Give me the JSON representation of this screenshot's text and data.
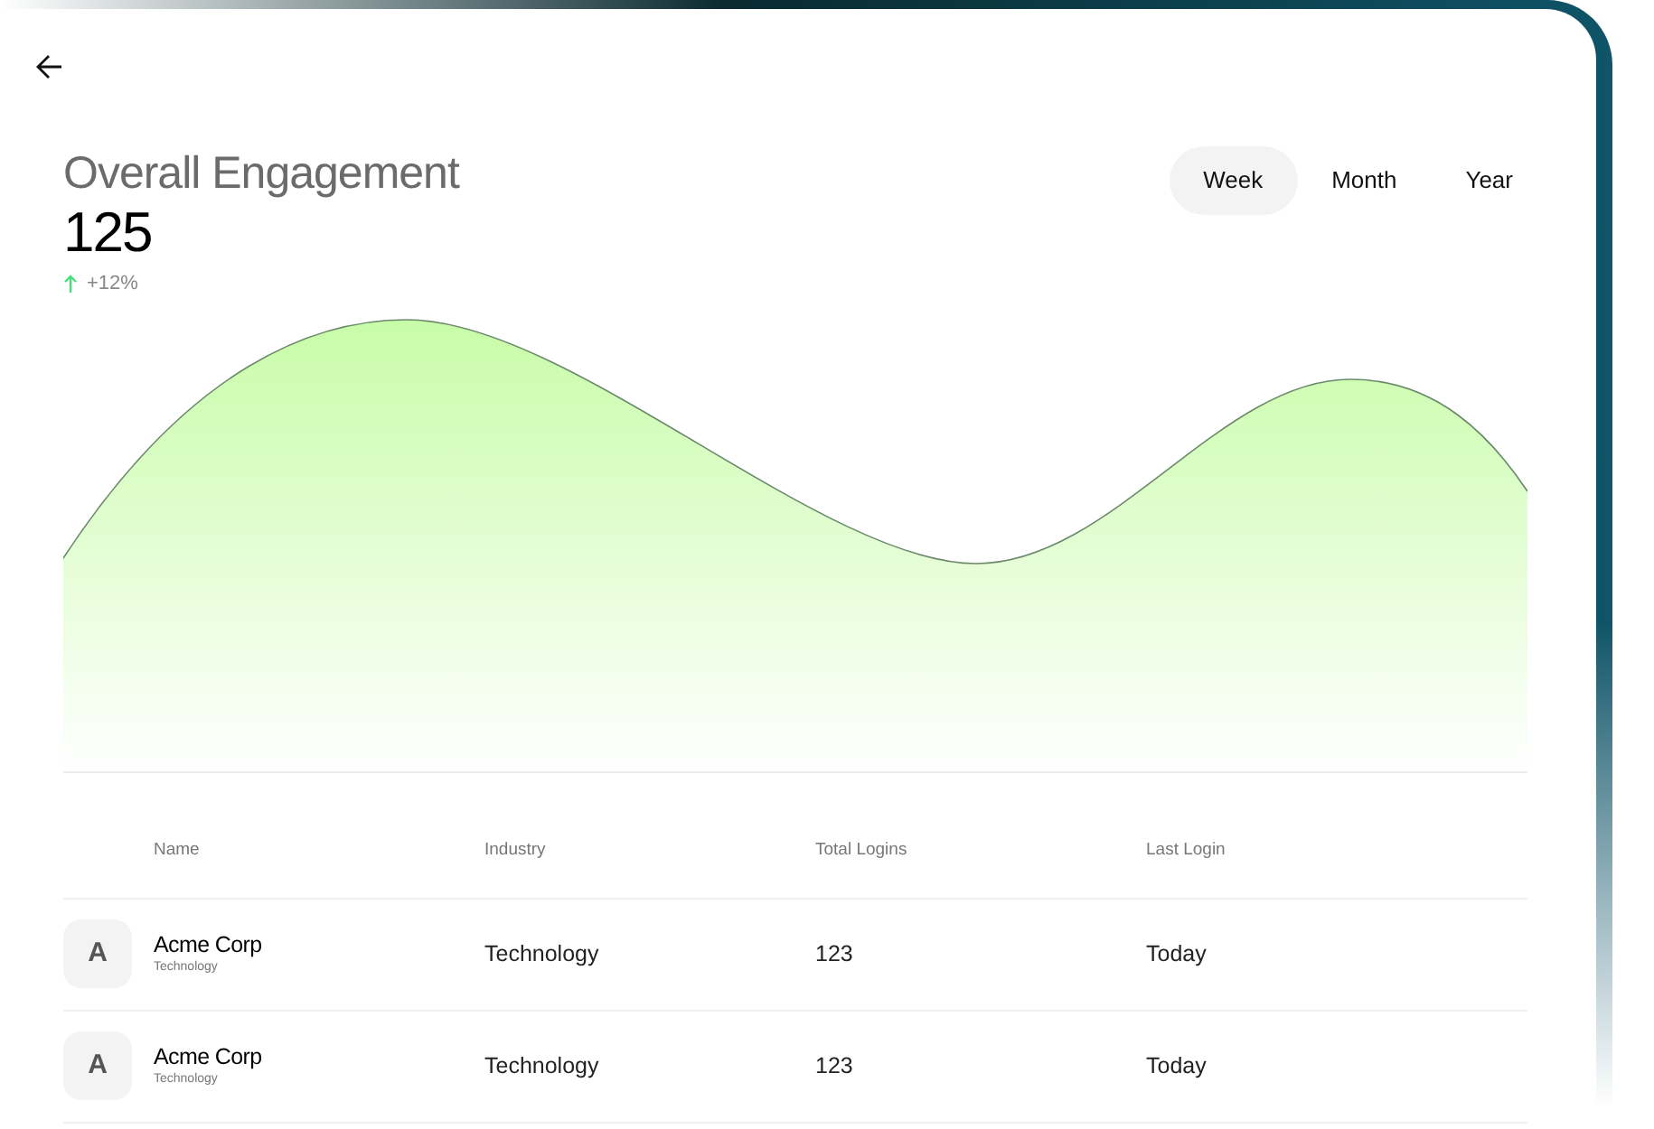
{
  "header": {
    "title": "Overall Engagement",
    "value": "125",
    "change": "+12%"
  },
  "periods": [
    {
      "label": "Week",
      "selected": true
    },
    {
      "label": "Month",
      "selected": false
    },
    {
      "label": "Year",
      "selected": false
    }
  ],
  "table": {
    "columns": [
      "Name",
      "Industry",
      "Total Logins",
      "Last Login"
    ],
    "rows": [
      {
        "initial": "A",
        "name": "Acme Corp",
        "subtitle": "Technology",
        "industry": "Technology",
        "total_logins": "123",
        "last_login": "Today"
      },
      {
        "initial": "A",
        "name": "Acme Corp",
        "subtitle": "Technology",
        "industry": "Technology",
        "total_logins": "123",
        "last_login": "Today"
      }
    ]
  }
}
